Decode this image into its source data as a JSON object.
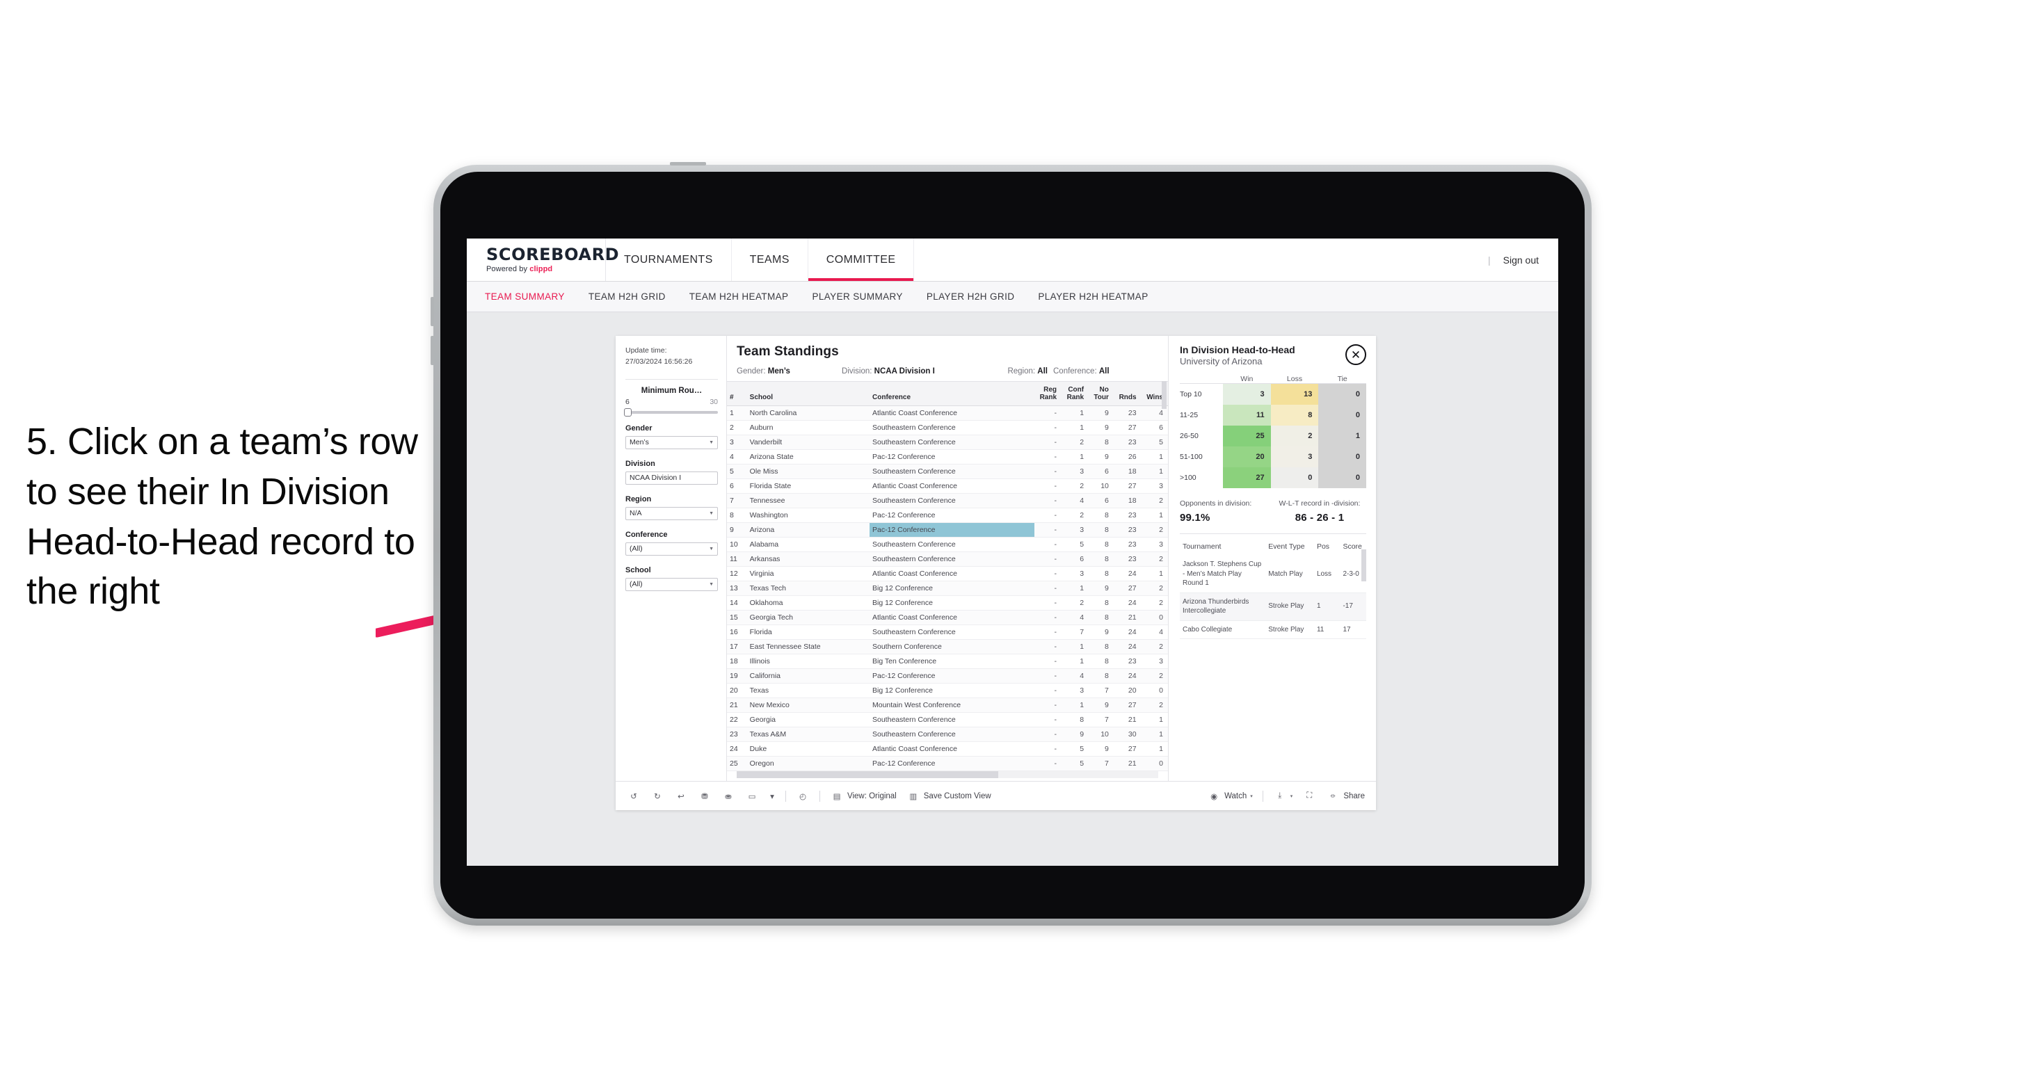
{
  "annotation": {
    "text": "5. Click on a team’s row to see their In Division Head-to-Head record to the right",
    "arrow_color": "#ec1d5c"
  },
  "app": {
    "brand": {
      "title": "SCOREBOARD",
      "powered_prefix": "Powered by ",
      "powered_brand": "clippd"
    },
    "main_nav": [
      {
        "label": "TOURNAMENTS",
        "active": false
      },
      {
        "label": "TEAMS",
        "active": false
      },
      {
        "label": "COMMITTEE",
        "active": true
      }
    ],
    "sign_out": {
      "separator": "|",
      "label": "Sign out"
    },
    "sub_nav": [
      {
        "label": "TEAM SUMMARY",
        "active": true
      },
      {
        "label": "TEAM H2H GRID",
        "active": false
      },
      {
        "label": "TEAM H2H HEATMAP",
        "active": false
      },
      {
        "label": "PLAYER SUMMARY",
        "active": false
      },
      {
        "label": "PLAYER H2H GRID",
        "active": false
      },
      {
        "label": "PLAYER H2H HEATMAP",
        "active": false
      }
    ]
  },
  "filters": {
    "update_time_label": "Update time:",
    "update_time_value": "27/03/2024 16:56:26",
    "slider": {
      "label": "Minimum Rou…",
      "min": "6",
      "max": "30"
    },
    "groups": [
      {
        "label": "Gender",
        "value": "Men’s"
      },
      {
        "label": "Division",
        "value": "NCAA Division I"
      },
      {
        "label": "Region",
        "value": "N/A"
      },
      {
        "label": "Conference",
        "value": "(All)"
      },
      {
        "label": "School",
        "value": "(All)"
      }
    ]
  },
  "standings": {
    "title": "Team Standings",
    "meta": [
      {
        "label": "Gender: ",
        "value": "Men’s"
      },
      {
        "label": "Division: ",
        "value": "NCAA Division I"
      },
      {
        "label": "Region: ",
        "value": "All"
      },
      {
        "label": "Conference: ",
        "value": "All"
      }
    ],
    "columns": [
      "#",
      "School",
      "Conference",
      "Reg Rank",
      "Conf Rank",
      "No Tour",
      "Rnds",
      "Wins"
    ],
    "rows": [
      {
        "n": "1",
        "school": "North Carolina",
        "conf": "Atlantic Coast Conference",
        "reg": "-",
        "confrank": "1",
        "notour": "9",
        "rnds": "23",
        "wins": "4",
        "selected": false
      },
      {
        "n": "2",
        "school": "Auburn",
        "conf": "Southeastern Conference",
        "reg": "-",
        "confrank": "1",
        "notour": "9",
        "rnds": "27",
        "wins": "6",
        "selected": false
      },
      {
        "n": "3",
        "school": "Vanderbilt",
        "conf": "Southeastern Conference",
        "reg": "-",
        "confrank": "2",
        "notour": "8",
        "rnds": "23",
        "wins": "5",
        "selected": false
      },
      {
        "n": "4",
        "school": "Arizona State",
        "conf": "Pac-12 Conference",
        "reg": "-",
        "confrank": "1",
        "notour": "9",
        "rnds": "26",
        "wins": "1",
        "selected": false
      },
      {
        "n": "5",
        "school": "Ole Miss",
        "conf": "Southeastern Conference",
        "reg": "-",
        "confrank": "3",
        "notour": "6",
        "rnds": "18",
        "wins": "1",
        "selected": false
      },
      {
        "n": "6",
        "school": "Florida State",
        "conf": "Atlantic Coast Conference",
        "reg": "-",
        "confrank": "2",
        "notour": "10",
        "rnds": "27",
        "wins": "3",
        "selected": false
      },
      {
        "n": "7",
        "school": "Tennessee",
        "conf": "Southeastern Conference",
        "reg": "-",
        "confrank": "4",
        "notour": "6",
        "rnds": "18",
        "wins": "2",
        "selected": false
      },
      {
        "n": "8",
        "school": "Washington",
        "conf": "Pac-12 Conference",
        "reg": "-",
        "confrank": "2",
        "notour": "8",
        "rnds": "23",
        "wins": "1",
        "selected": false
      },
      {
        "n": "9",
        "school": "Arizona",
        "conf": "Pac-12 Conference",
        "reg": "-",
        "confrank": "3",
        "notour": "8",
        "rnds": "23",
        "wins": "2",
        "selected": true
      },
      {
        "n": "10",
        "school": "Alabama",
        "conf": "Southeastern Conference",
        "reg": "-",
        "confrank": "5",
        "notour": "8",
        "rnds": "23",
        "wins": "3",
        "selected": false
      },
      {
        "n": "11",
        "school": "Arkansas",
        "conf": "Southeastern Conference",
        "reg": "-",
        "confrank": "6",
        "notour": "8",
        "rnds": "23",
        "wins": "2",
        "selected": false
      },
      {
        "n": "12",
        "school": "Virginia",
        "conf": "Atlantic Coast Conference",
        "reg": "-",
        "confrank": "3",
        "notour": "8",
        "rnds": "24",
        "wins": "1",
        "selected": false
      },
      {
        "n": "13",
        "school": "Texas Tech",
        "conf": "Big 12 Conference",
        "reg": "-",
        "confrank": "1",
        "notour": "9",
        "rnds": "27",
        "wins": "2",
        "selected": false
      },
      {
        "n": "14",
        "school": "Oklahoma",
        "conf": "Big 12 Conference",
        "reg": "-",
        "confrank": "2",
        "notour": "8",
        "rnds": "24",
        "wins": "2",
        "selected": false
      },
      {
        "n": "15",
        "school": "Georgia Tech",
        "conf": "Atlantic Coast Conference",
        "reg": "-",
        "confrank": "4",
        "notour": "8",
        "rnds": "21",
        "wins": "0",
        "selected": false
      },
      {
        "n": "16",
        "school": "Florida",
        "conf": "Southeastern Conference",
        "reg": "-",
        "confrank": "7",
        "notour": "9",
        "rnds": "24",
        "wins": "4",
        "selected": false
      },
      {
        "n": "17",
        "school": "East Tennessee State",
        "conf": "Southern Conference",
        "reg": "-",
        "confrank": "1",
        "notour": "8",
        "rnds": "24",
        "wins": "2",
        "selected": false
      },
      {
        "n": "18",
        "school": "Illinois",
        "conf": "Big Ten Conference",
        "reg": "-",
        "confrank": "1",
        "notour": "8",
        "rnds": "23",
        "wins": "3",
        "selected": false
      },
      {
        "n": "19",
        "school": "California",
        "conf": "Pac-12 Conference",
        "reg": "-",
        "confrank": "4",
        "notour": "8",
        "rnds": "24",
        "wins": "2",
        "selected": false
      },
      {
        "n": "20",
        "school": "Texas",
        "conf": "Big 12 Conference",
        "reg": "-",
        "confrank": "3",
        "notour": "7",
        "rnds": "20",
        "wins": "0",
        "selected": false
      },
      {
        "n": "21",
        "school": "New Mexico",
        "conf": "Mountain West Conference",
        "reg": "-",
        "confrank": "1",
        "notour": "9",
        "rnds": "27",
        "wins": "2",
        "selected": false
      },
      {
        "n": "22",
        "school": "Georgia",
        "conf": "Southeastern Conference",
        "reg": "-",
        "confrank": "8",
        "notour": "7",
        "rnds": "21",
        "wins": "1",
        "selected": false
      },
      {
        "n": "23",
        "school": "Texas A&M",
        "conf": "Southeastern Conference",
        "reg": "-",
        "confrank": "9",
        "notour": "10",
        "rnds": "30",
        "wins": "1",
        "selected": false
      },
      {
        "n": "24",
        "school": "Duke",
        "conf": "Atlantic Coast Conference",
        "reg": "-",
        "confrank": "5",
        "notour": "9",
        "rnds": "27",
        "wins": "1",
        "selected": false
      },
      {
        "n": "25",
        "school": "Oregon",
        "conf": "Pac-12 Conference",
        "reg": "-",
        "confrank": "5",
        "notour": "7",
        "rnds": "21",
        "wins": "0",
        "selected": false
      }
    ]
  },
  "detail": {
    "title": "In Division Head-to-Head",
    "subtitle": "University of Arizona",
    "close_icon": "✕",
    "kpis": [
      {
        "label": "Opponents in division:",
        "value": "99.1%"
      },
      {
        "label": "W-L-T record in -division:",
        "value": "86 - 26 - 1"
      }
    ],
    "tournaments": {
      "columns": [
        "Tournament",
        "Event Type",
        "Pos",
        "Score"
      ],
      "rows": [
        {
          "name": "Jackson T. Stephens Cup - Men’s Match Play Round 1",
          "type": "Match Play",
          "pos": "Loss",
          "score": "2-3-0"
        },
        {
          "name": "Arizona Thunderbirds Intercollegiate",
          "type": "Stroke Play",
          "pos": "1",
          "score": "-17"
        },
        {
          "name": "Cabo Collegiate",
          "type": "Stroke Play",
          "pos": "11",
          "score": "17"
        }
      ]
    }
  },
  "chart_data": {
    "type": "heatmap",
    "title": "In Division Head-to-Head",
    "subtitle": "University of Arizona",
    "columns": [
      "Win",
      "Loss",
      "Tie"
    ],
    "rows": [
      "Top 10",
      "11-25",
      "26-50",
      "51-100",
      ">100"
    ],
    "values": [
      [
        3,
        13,
        0
      ],
      [
        11,
        8,
        0
      ],
      [
        25,
        2,
        1
      ],
      [
        20,
        3,
        0
      ],
      [
        27,
        0,
        0
      ]
    ],
    "cell_colors": [
      [
        "#e4efe2",
        "#f4e09a",
        "#d3d3d3"
      ],
      [
        "#c9e6bd",
        "#f7ecc4",
        "#d3d3d3"
      ],
      [
        "#85d07a",
        "#f0efe6",
        "#d3d3d3"
      ],
      [
        "#95d586",
        "#f1efe7",
        "#d3d3d3"
      ],
      [
        "#8bd17c",
        "#eeeeec",
        "#d3d3d3"
      ]
    ],
    "legend_position": "none",
    "grid": false
  },
  "toolbar": {
    "items": [
      {
        "name": "undo",
        "icon": "↺"
      },
      {
        "name": "redo",
        "icon": "↻"
      },
      {
        "name": "revert",
        "icon": "↩"
      },
      {
        "name": "refresh",
        "icon": "⟳"
      },
      {
        "name": "pause",
        "icon": "⏸"
      },
      {
        "name": "highlight",
        "icon": "▭"
      }
    ],
    "view_label": "View: Original",
    "save_label": "Save Custom View",
    "watch_label": "Watch",
    "share_label": "Share"
  }
}
